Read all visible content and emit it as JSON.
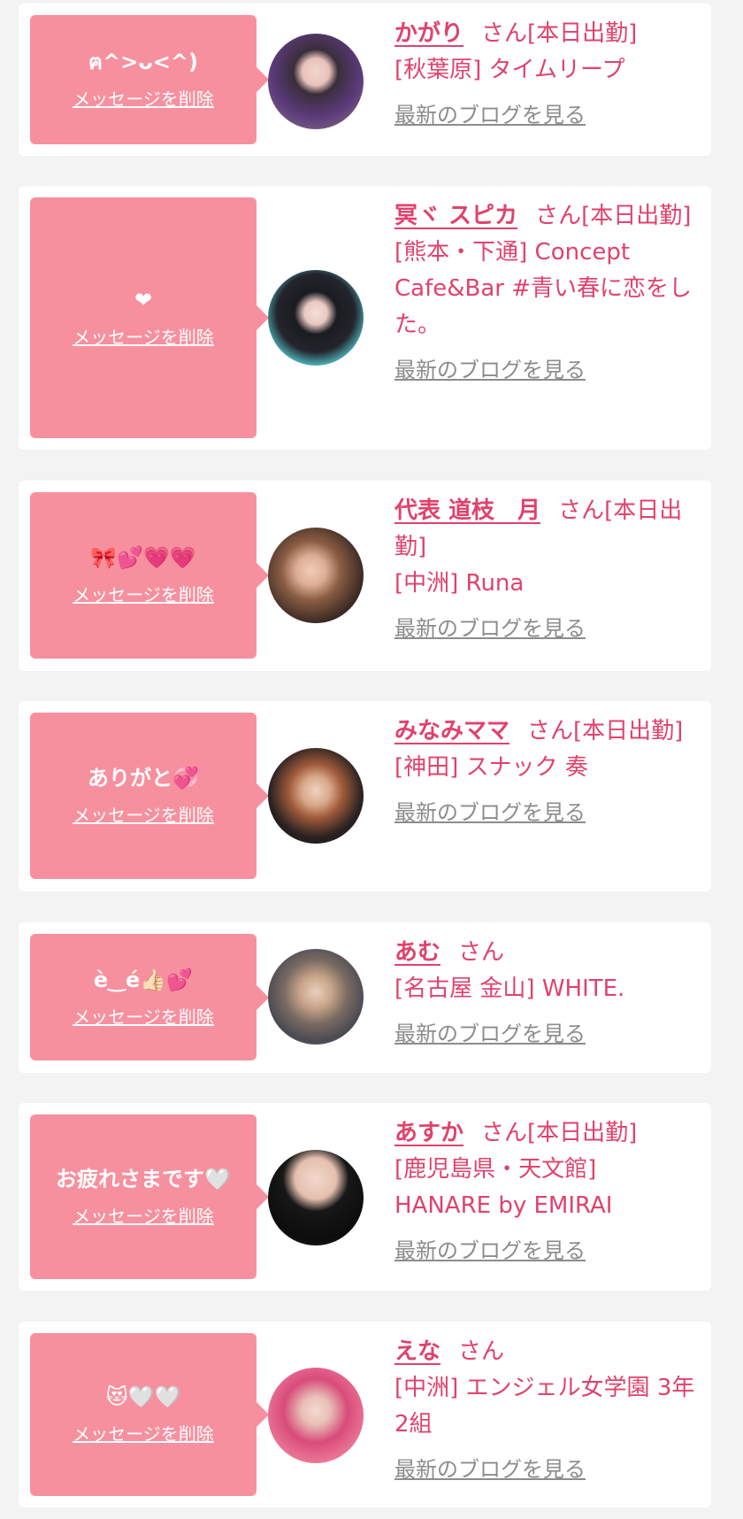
{
  "colors": {
    "accent": "#e0426c",
    "bubble": "#f7909e",
    "link_gray": "#8c8c8c",
    "background": "#f3f3f3"
  },
  "labels": {
    "delete": "メッセージを削除",
    "blog": "最新のブログを見る"
  },
  "items": [
    {
      "message": "ฅ^>ᴗ<^)",
      "name": "かがり",
      "suffix": "さん[本日出勤]",
      "shop": "[秋葉原] タイムリープ"
    },
    {
      "message": "❤",
      "name": "冥ヾ スピカ",
      "suffix": "さん[本日出勤]",
      "shop": "[熊本・下通] Concept Cafe&Bar #青い春に恋をした。"
    },
    {
      "message": "🎀💕💗💗",
      "name": "代表 道枝　月",
      "suffix": "さん[本日出勤]",
      "shop": "[中洲] Runa"
    },
    {
      "message": "ありがと💞",
      "name": "みなみママ",
      "suffix": "さん[本日出勤]",
      "shop": "[神田] スナック 奏"
    },
    {
      "message": "è‿é👍🏻💕",
      "name": "あむ",
      "suffix": "さん",
      "shop": "[名古屋 金山] WHITE."
    },
    {
      "message": "お疲れさまです🤍",
      "name": "あすか",
      "suffix": "さん[本日出勤]",
      "shop": "[鹿児島県・天文館] HANARE by EMIRAI"
    },
    {
      "message": "😻🤍🤍",
      "name": "えな",
      "suffix": "さん",
      "shop": "[中洲] エンジェル女学園 3年2組"
    }
  ]
}
